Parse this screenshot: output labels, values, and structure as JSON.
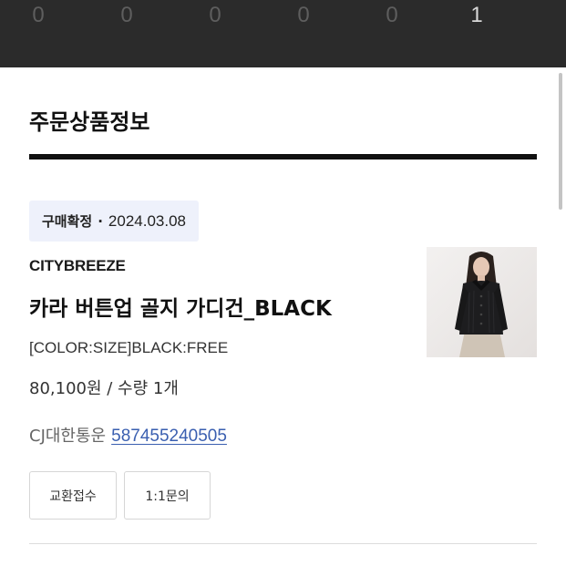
{
  "progress_steps": [
    {
      "count": "0",
      "active": false
    },
    {
      "count": "0",
      "active": false
    },
    {
      "count": "0",
      "active": false
    },
    {
      "count": "0",
      "active": false
    },
    {
      "count": "0",
      "active": false
    },
    {
      "count": "1",
      "active": true
    }
  ],
  "section_title": "주문상품정보",
  "order": {
    "status_label": "구매확정",
    "status_separator": "·",
    "status_date": "2024.03.08",
    "brand": "CITYBREEZE",
    "product_name": "카라 버튼업 골지 가디건_BLACK",
    "option": "[COLOR:SIZE]BLACK:FREE",
    "price_qty": "80,100원 / 수량 1개",
    "courier": "CJ대한통운",
    "tracking_number": "587455240505"
  },
  "buttons": {
    "exchange": "교환접수",
    "inquiry": "1:1문의"
  },
  "colors": {
    "topbar": "#2b2b2b",
    "badge_bg": "#eef1fb",
    "link": "#3a5fb0"
  },
  "icons": {
    "product_thumbnail": "product-photo"
  }
}
